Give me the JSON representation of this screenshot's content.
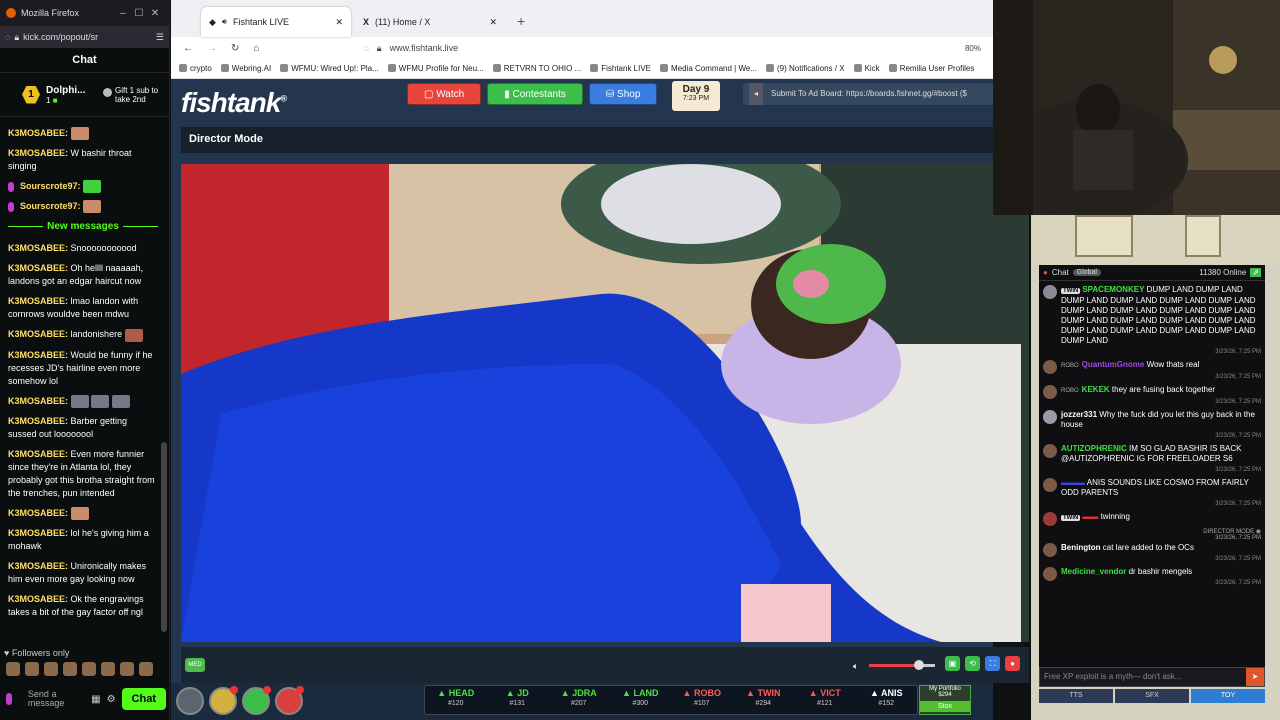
{
  "popout": {
    "window_title": "Mozilla Firefox",
    "url": "kick.com/popout/sr",
    "chat_title": "Chat",
    "pinned_user": "Dolphi...",
    "pinned_rank": "1",
    "pinned_level": "1",
    "gift_text": "Gift 1 sub to take 2nd",
    "messages": [
      {
        "user": "K3MOSABEE:",
        "text": ""
      },
      {
        "user": "K3MOSABEE:",
        "text": "W bashir throat singing"
      },
      {
        "user": "Sourscrote97:",
        "text": ""
      },
      {
        "user": "Sourscrote97:",
        "text": ""
      }
    ],
    "new_messages_label": "New messages",
    "new_messages": [
      {
        "user": "K3MOSABEE:",
        "text": "Snooooooooood"
      },
      {
        "user": "K3MOSABEE:",
        "text": "Oh hellll naaaaah, landons got an edgar haircut now"
      },
      {
        "user": "K3MOSABEE:",
        "text": "lmao landon with cornrows wouldve been mdwu"
      },
      {
        "user": "K3MOSABEE:",
        "text": "landonishere"
      },
      {
        "user": "K3MOSABEE:",
        "text": "Would be funny if he recesses JD's hairline even more somehow lol"
      },
      {
        "user": "K3MOSABEE:",
        "text": ""
      },
      {
        "user": "K3MOSABEE:",
        "text": "Barber getting sussed out loooooool"
      },
      {
        "user": "K3MOSABEE:",
        "text": "Even more funnier since they're in Atlanta lol, they probably got this brotha straight from the trenches, pun intended"
      },
      {
        "user": "K3MOSABEE:",
        "text": ""
      },
      {
        "user": "K3MOSABEE:",
        "text": "lol he's giving him a mohawk"
      },
      {
        "user": "K3MOSABEE:",
        "text": "Unironically makes him even more gay looking now"
      },
      {
        "user": "K3MOSABEE:",
        "text": "Ok the engravings takes a bit of the gay factor off ngl"
      }
    ],
    "followers_only": "Followers only",
    "send_placeholder": "Send a message",
    "chat_button": "Chat"
  },
  "browser": {
    "tabs": [
      {
        "label": "Fishtank LIVE",
        "active": true
      },
      {
        "label": "(11) Home / X",
        "active": false
      }
    ],
    "address": "www.fishtank.live",
    "zoom": "80%",
    "bookmarks": [
      "crypto",
      "Webring.AI",
      "WFMU: Wired Up!: Pla...",
      "WFMU Profile for Neu...",
      "RETVRN TO OHIO ...",
      "Fishtank LIVE",
      "Media Command | We...",
      "(9) Notifications / X",
      "Kick",
      "Remilia User Profiles"
    ]
  },
  "site": {
    "logo": "fishtank",
    "nav": [
      {
        "label": "Watch",
        "color": "#e8453c"
      },
      {
        "label": "Contestants",
        "color": "#3cbf4a"
      },
      {
        "label": "Shop",
        "color": "#3a7de0"
      }
    ],
    "day": "Day 9",
    "time": "7:23 PM",
    "adboard": "Submit To Ad Board: https://boards.fishnet.gg/#boost ($",
    "director_mode": "Director Mode",
    "med_label": "MED",
    "volume_level": 0.75,
    "contestants": [
      {
        "name": "HEAD",
        "score": "#120",
        "trend": "up"
      },
      {
        "name": "JD",
        "score": "#131",
        "trend": "up"
      },
      {
        "name": "JDRA",
        "score": "#207",
        "trend": "up"
      },
      {
        "name": "LAND",
        "score": "#300",
        "trend": "up"
      },
      {
        "name": "ROBO",
        "score": "#107",
        "trend": "down"
      },
      {
        "name": "TWIN",
        "score": "#294",
        "trend": "down"
      },
      {
        "name": "VICT",
        "score": "#121",
        "trend": "down"
      },
      {
        "name": "ANIS",
        "score": "#152",
        "trend": "neutral"
      }
    ],
    "portfolio_label": "My Portfolio",
    "portfolio_value": "$294",
    "stox_label": "Stox"
  },
  "site_chat": {
    "title": "Chat",
    "global": "Global",
    "online": "11380 Online",
    "messages": [
      {
        "tag": "TWIN",
        "user": "SPACEMONKEY",
        "user_color": "#3fe03f",
        "text": "DUMP LAND DUMP LAND DUMP LAND DUMP LAND DUMP LAND DUMP LAND DUMP LAND DUMP LAND DUMP LAND DUMP LAND DUMP LAND DUMP LAND DUMP LAND DUMP LAND DUMP LAND DUMP LAND DUMP LAND DUMP LAND DUMP LAND",
        "ts": "3/23/26, 7:25 PM"
      },
      {
        "tag": "ROBO",
        "user": "QuantumGnome",
        "user_color": "#a04be0",
        "text": "Wow thats real",
        "ts": "3/23/26, 7:25 PM"
      },
      {
        "tag": "ROBO",
        "user": "KEKEK",
        "user_color": "#3fe03f",
        "text": "they are fusing back together",
        "ts": "3/23/26, 7:25 PM"
      },
      {
        "tag": "",
        "user": "jozzer331",
        "user_color": "#ffffff",
        "text": "Why the fuck did you let this guy back in the house",
        "ts": "3/23/26, 7:25 PM"
      },
      {
        "tag": "",
        "user": "AUTIZOPHRENIC",
        "user_color": "#3fe03f",
        "text": "IM SO GLAD BASHIR IS BACK @AUTIZOPHRENIC IG FOR FREELOADER S6",
        "ts": "3/23/26, 7:25 PM"
      },
      {
        "tag": "",
        "user": "",
        "user_color": "#3a45e0",
        "text": "ANIS SOUNDS LIKE COSMO FROM FAIRLY ODD PARENTS",
        "ts": "3/23/26, 7:25 PM"
      },
      {
        "tag": "TWIN",
        "user": "",
        "user_color": "#e03030",
        "text": "twinning",
        "ts": ""
      },
      {
        "tag": "",
        "user": "Benington",
        "user_color": "#ffffff",
        "text": "cat lare added to the OCs",
        "ts": "3/23/26, 7:25 PM"
      },
      {
        "tag": "",
        "user": "Medicine_vendor",
        "user_color": "#3fe03f",
        "text": "dr bashir mengels",
        "ts": "3/23/26, 7:25 PM"
      }
    ],
    "director_note": "DIRECTOR MODE",
    "director_ts": "3/23/26, 7:25 PM",
    "input_placeholder": "Free XP exploit is a myth— don't ask...",
    "buttons": [
      "TTS",
      "SFX",
      "TOY"
    ]
  }
}
